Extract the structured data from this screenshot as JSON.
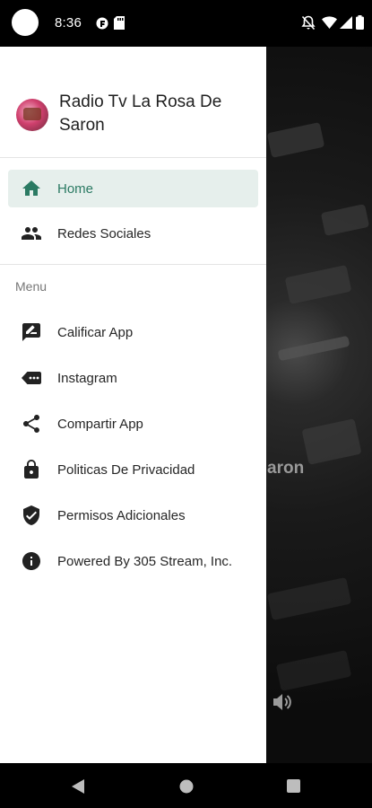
{
  "status_bar": {
    "time": "8:36",
    "icons": [
      "avatar-circle",
      "app-notification-icon",
      "sd-card-icon",
      "mute-icon",
      "wifi-icon",
      "signal-icon",
      "battery-icon"
    ]
  },
  "drawer": {
    "app_title": "Radio Tv La Rosa De Saron",
    "primary_items": [
      {
        "label": "Home",
        "icon": "home-icon",
        "active": true
      },
      {
        "label": "Redes Sociales",
        "icon": "people-icon",
        "active": false
      }
    ],
    "section_title": "Menu",
    "menu_items": [
      {
        "label": "Calificar App",
        "icon": "rate-review-icon"
      },
      {
        "label": "Instagram",
        "icon": "label-tag-icon"
      },
      {
        "label": "Compartir App",
        "icon": "share-icon"
      },
      {
        "label": "Politicas De Privacidad",
        "icon": "lock-icon"
      },
      {
        "label": "Permisos Adicionales",
        "icon": "shield-check-icon"
      },
      {
        "label": "Powered By 305 Stream, Inc.",
        "icon": "info-icon"
      }
    ]
  },
  "background": {
    "partial_title": "aron",
    "speaker_icon": "volume-icon"
  },
  "nav_bar": {
    "buttons": [
      "back-button",
      "home-button",
      "recents-button"
    ]
  },
  "colors": {
    "accent": "#2b7a63",
    "active_bg": "#e6efec"
  }
}
